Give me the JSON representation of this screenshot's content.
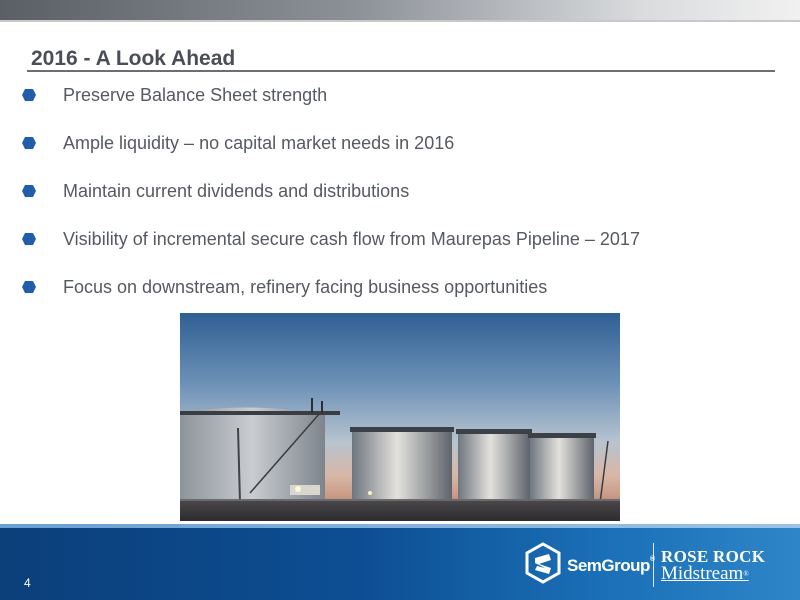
{
  "slide": {
    "title": "2016 - A Look Ahead",
    "bullets": [
      "Preserve Balance Sheet strength",
      "Ample liquidity – no capital market needs in 2016",
      "Maintain current dividends and distributions",
      "Visibility of incremental secure cash flow from Maurepas Pipeline – 2017",
      "Focus on downstream, refinery facing business opportunities"
    ],
    "page_number": "4"
  },
  "logos": {
    "semgroup": "SemGroup",
    "semgroup_mark": "®",
    "rose_rock_line1": "ROSE ROCK",
    "rose_rock_line2": "Midstream",
    "rose_rock_mark": "®"
  },
  "colors": {
    "bullet": "#1f5fa8",
    "footer_blue": "#0d4e93",
    "title_text": "#4a4f57"
  },
  "image": {
    "subject": "oil-storage-tanks-photo"
  }
}
